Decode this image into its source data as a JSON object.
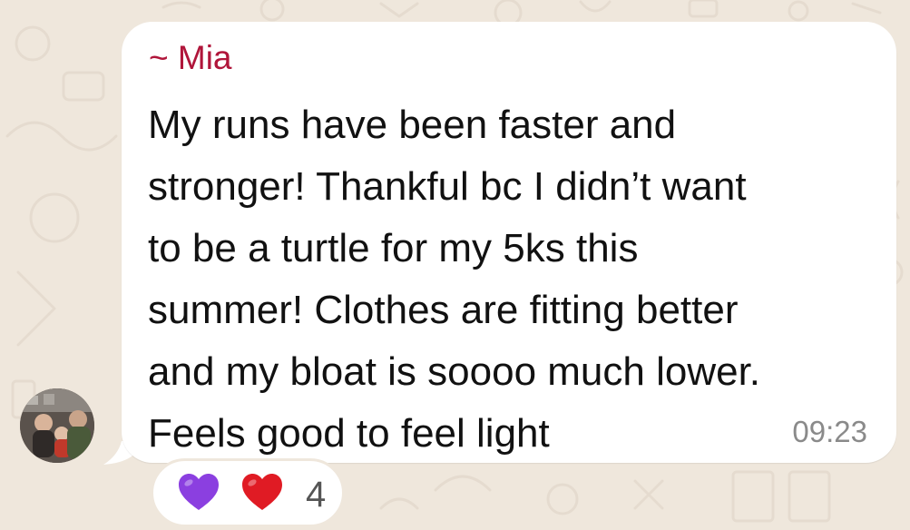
{
  "message": {
    "sender": "~ Mia",
    "lines": [
      "My runs have been faster and",
      "stronger! Thankful bc I didn’t want",
      "to be a turtle for my 5ks this",
      "summer! Clothes are fitting better",
      "and my bloat is soooo much lower.",
      "Feels good to feel light"
    ],
    "time": "09:23"
  },
  "reactions": {
    "emojis": [
      "purple-heart-icon",
      "red-heart-icon"
    ],
    "count": "4"
  },
  "colors": {
    "sender": "#b0153a",
    "background": "#efe7dc",
    "bubble": "#ffffff",
    "purple_heart": "#8b3fe0",
    "red_heart": "#e01b24"
  }
}
